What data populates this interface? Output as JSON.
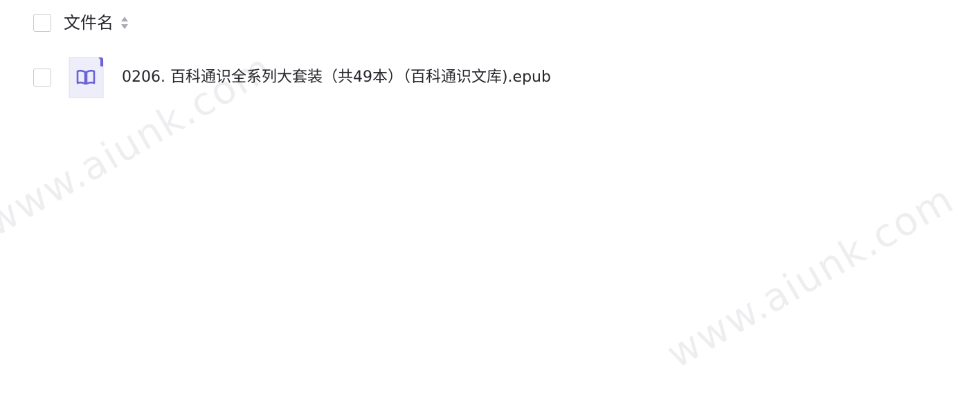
{
  "header": {
    "column_label": "文件名"
  },
  "files": [
    {
      "name": "0206. 百科通识全系列大套装（共49本）（百科通识文库).epub",
      "icon": "epub-book-icon"
    }
  ],
  "watermark": {
    "text": "www.aiunk.com"
  },
  "colors": {
    "text": "#25262b",
    "checkbox_border": "#c9cbd1",
    "file_icon_bg": "#eeeefb",
    "file_icon_accent": "#6a63d6"
  }
}
